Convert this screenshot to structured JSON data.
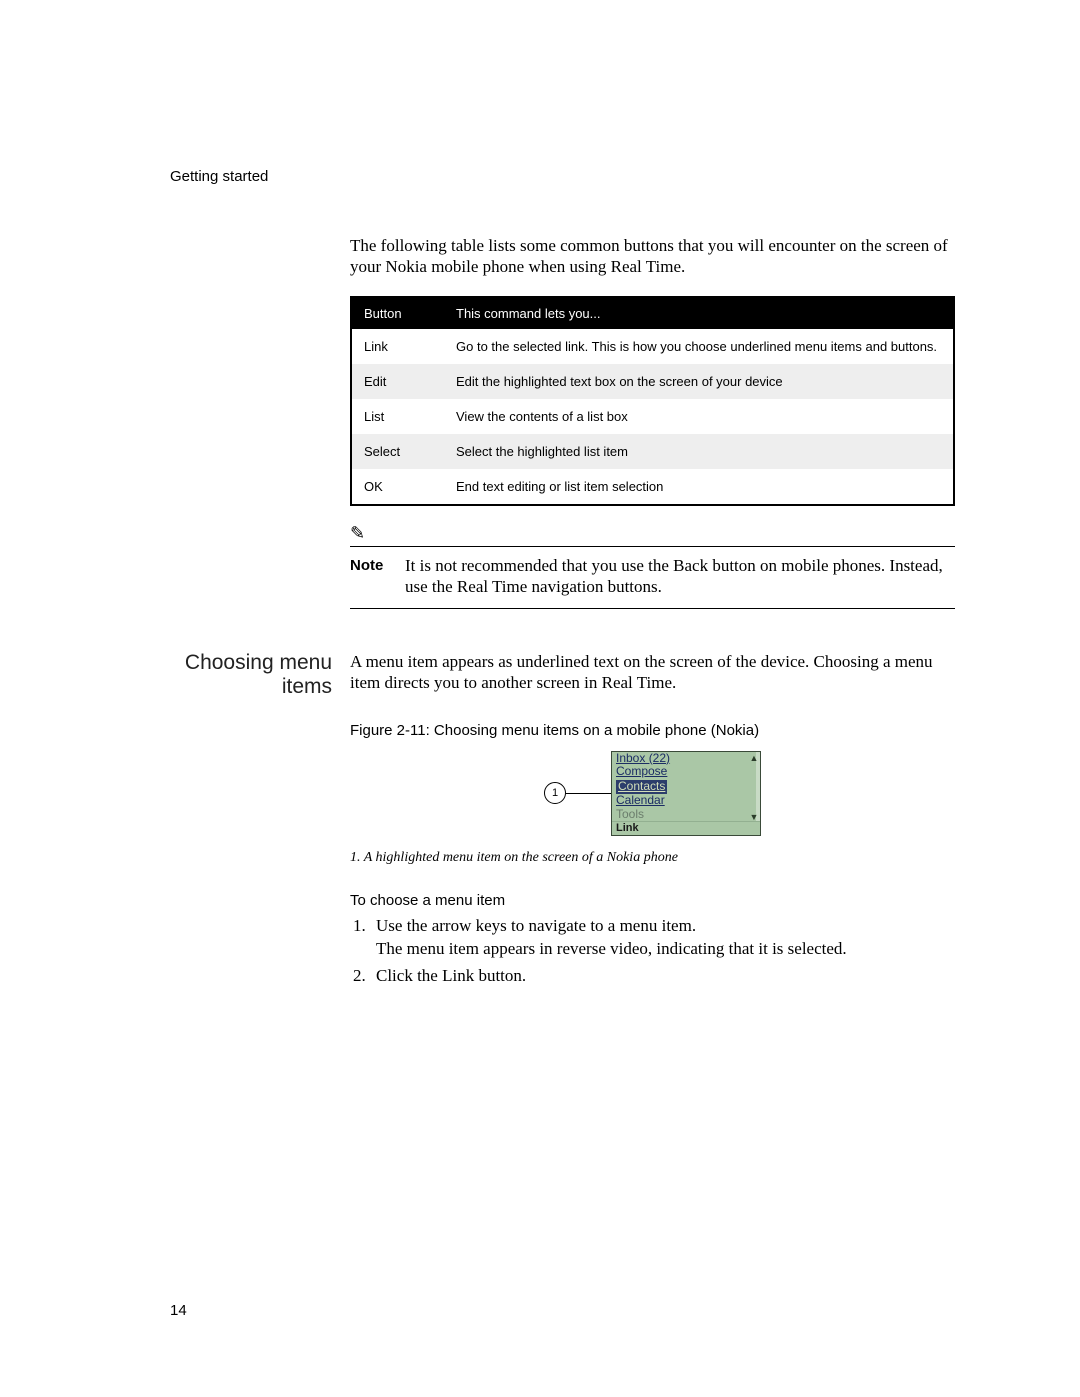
{
  "header": {
    "section": "Getting started"
  },
  "intro": "The following table lists some common buttons that you will encounter on the screen of your Nokia mobile phone when using Real Time.",
  "table": {
    "headers": {
      "col1": "Button",
      "col2": "This command lets you..."
    },
    "rows": [
      {
        "button": "Link",
        "desc": "Go to the selected link. This is how you choose underlined menu items and buttons."
      },
      {
        "button": "Edit",
        "desc": "Edit the highlighted text box on the screen of your device"
      },
      {
        "button": "List",
        "desc": "View the contents of a list box"
      },
      {
        "button": "Select",
        "desc": "Select the highlighted list item"
      },
      {
        "button": "OK",
        "desc": "End text editing or list item selection"
      }
    ]
  },
  "note": {
    "icon": "✎",
    "label": "Note",
    "text": "It is not recommended that you use the Back button on mobile phones. Instead, use the Real Time navigation buttons."
  },
  "side_heading": "Choosing menu items",
  "menu_para": "A menu item appears as underlined text on the screen of the device. Choosing a menu item directs you to another screen in Real Time.",
  "figure": {
    "caption": "Figure 2-11: Choosing menu items on a mobile phone (Nokia)",
    "callout": "1",
    "screen": {
      "items": {
        "inbox": "Inbox (22)",
        "compose": "Compose",
        "contacts": "Contacts",
        "calendar": "Calendar",
        "tools": "Tools"
      },
      "softkey": "Link"
    },
    "legend": "1. A highlighted menu item on the screen of a Nokia phone"
  },
  "procedure": {
    "title": "To choose a menu item",
    "steps": {
      "s1a": "Use the arrow keys to navigate to a menu item.",
      "s1b": "The menu item appears in reverse video, indicating that it is selected.",
      "s2": "Click the Link button."
    }
  },
  "page_number": "14"
}
